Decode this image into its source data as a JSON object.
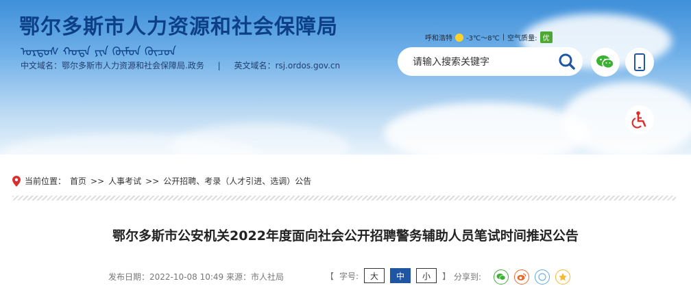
{
  "header": {
    "site_title": "鄂尔多斯市人力资源和社会保障局",
    "mongolian_text": "ᠣᠷᠳᠣᠰ ᠬᠣᠲᠠ ᠶᠢᠨ ᠬᠦᠮᠦᠨ ᠬᠦᠴᠦᠨ",
    "cn_domain": "中文域名：鄂尔多斯市人力资源和社会保障局.政务",
    "separator": "|",
    "en_domain": "英文域名：rsj.ordos.gov.cn"
  },
  "weather": {
    "city": "呼和浩特",
    "temp": "-3℃～8℃",
    "sep": "|",
    "aq_label": "空气质量:",
    "aq_value": "优"
  },
  "search": {
    "placeholder": "请输入搜索关键字"
  },
  "breadcrumb": {
    "label": "当前位置：",
    "home": "首页",
    "sep1": ">>",
    "level1": "人事考试",
    "sep2": ">>",
    "level2": "公开招聘、考录（人才引进、选调）公告"
  },
  "article": {
    "title": "鄂尔多斯市公安机关2022年度面向社会公开招聘警务辅助人员笔试时间推迟公告",
    "publish_label": "发布日期：",
    "publish_date": "2022-10-08 10:49",
    "source_label": "来源：",
    "source": "市人社局"
  },
  "font_size": {
    "bracket_open": "【",
    "label": "字号:",
    "large": "大",
    "medium": "中",
    "small": "小",
    "bracket_close": "】"
  },
  "share": {
    "label": "分享到:"
  },
  "colors": {
    "title_blue": "#0c3f86",
    "active_blue": "#1f56a3",
    "wechat_green": "#3cb034",
    "weibo_orange": "#e86a2d",
    "qzone_yellow": "#f5b82e",
    "accessibility_red": "#d9302f"
  }
}
